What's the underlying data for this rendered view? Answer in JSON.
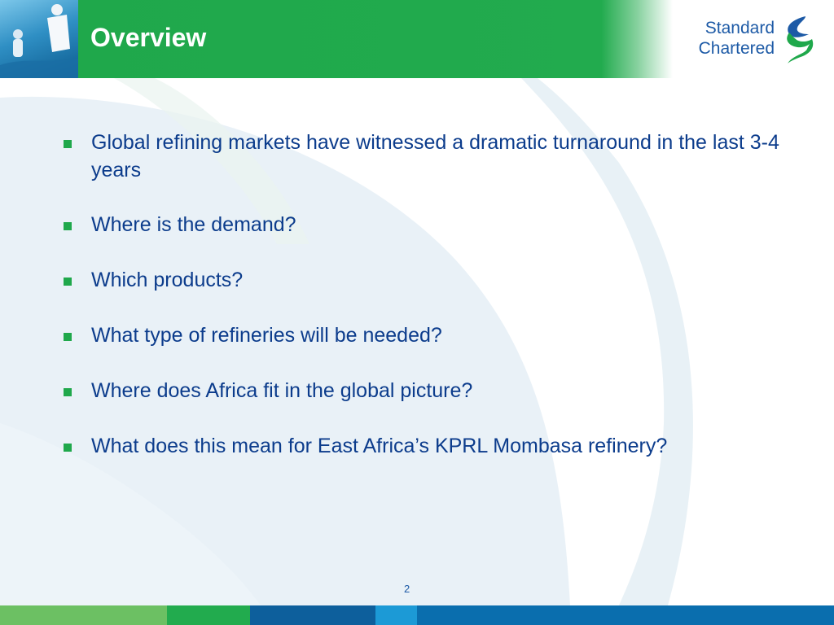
{
  "slide": {
    "title": "Overview",
    "page_number": "2"
  },
  "logo": {
    "line1": "Standard",
    "line2": "Chartered",
    "name": "standard-chartered-logo"
  },
  "bullets": [
    "Global refining markets have witnessed a dramatic turnaround in the last 3-4 years",
    "Where is the demand?",
    "Which products?",
    "What type of refineries will be needed?",
    "Where does Africa fit in the global picture?",
    "What does this mean for East Africa’s KPRL Mombasa refinery?"
  ],
  "colors": {
    "green": "#1fa84b",
    "blue_text": "#0c3c8c",
    "logo_blue": "#1d5aa6",
    "footer": [
      "#6cc063",
      "#22ab4e",
      "#0d5f9c",
      "#1c9ad6",
      "#0a6eae"
    ]
  }
}
